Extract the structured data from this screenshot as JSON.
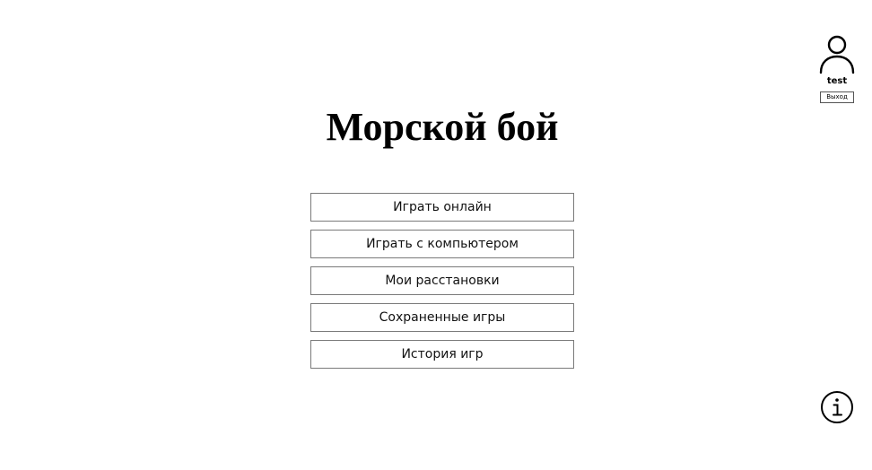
{
  "app": {
    "title": "Морской бой"
  },
  "menu": {
    "items": [
      {
        "label": "Играть онлайн"
      },
      {
        "label": "Играть с компьютером"
      },
      {
        "label": "Мои расстановки"
      },
      {
        "label": "Сохраненные игры"
      },
      {
        "label": "История игр"
      }
    ]
  },
  "user": {
    "icon": "user-icon",
    "name": "test",
    "logout_label": "Выход"
  },
  "info": {
    "icon": "info-icon"
  }
}
